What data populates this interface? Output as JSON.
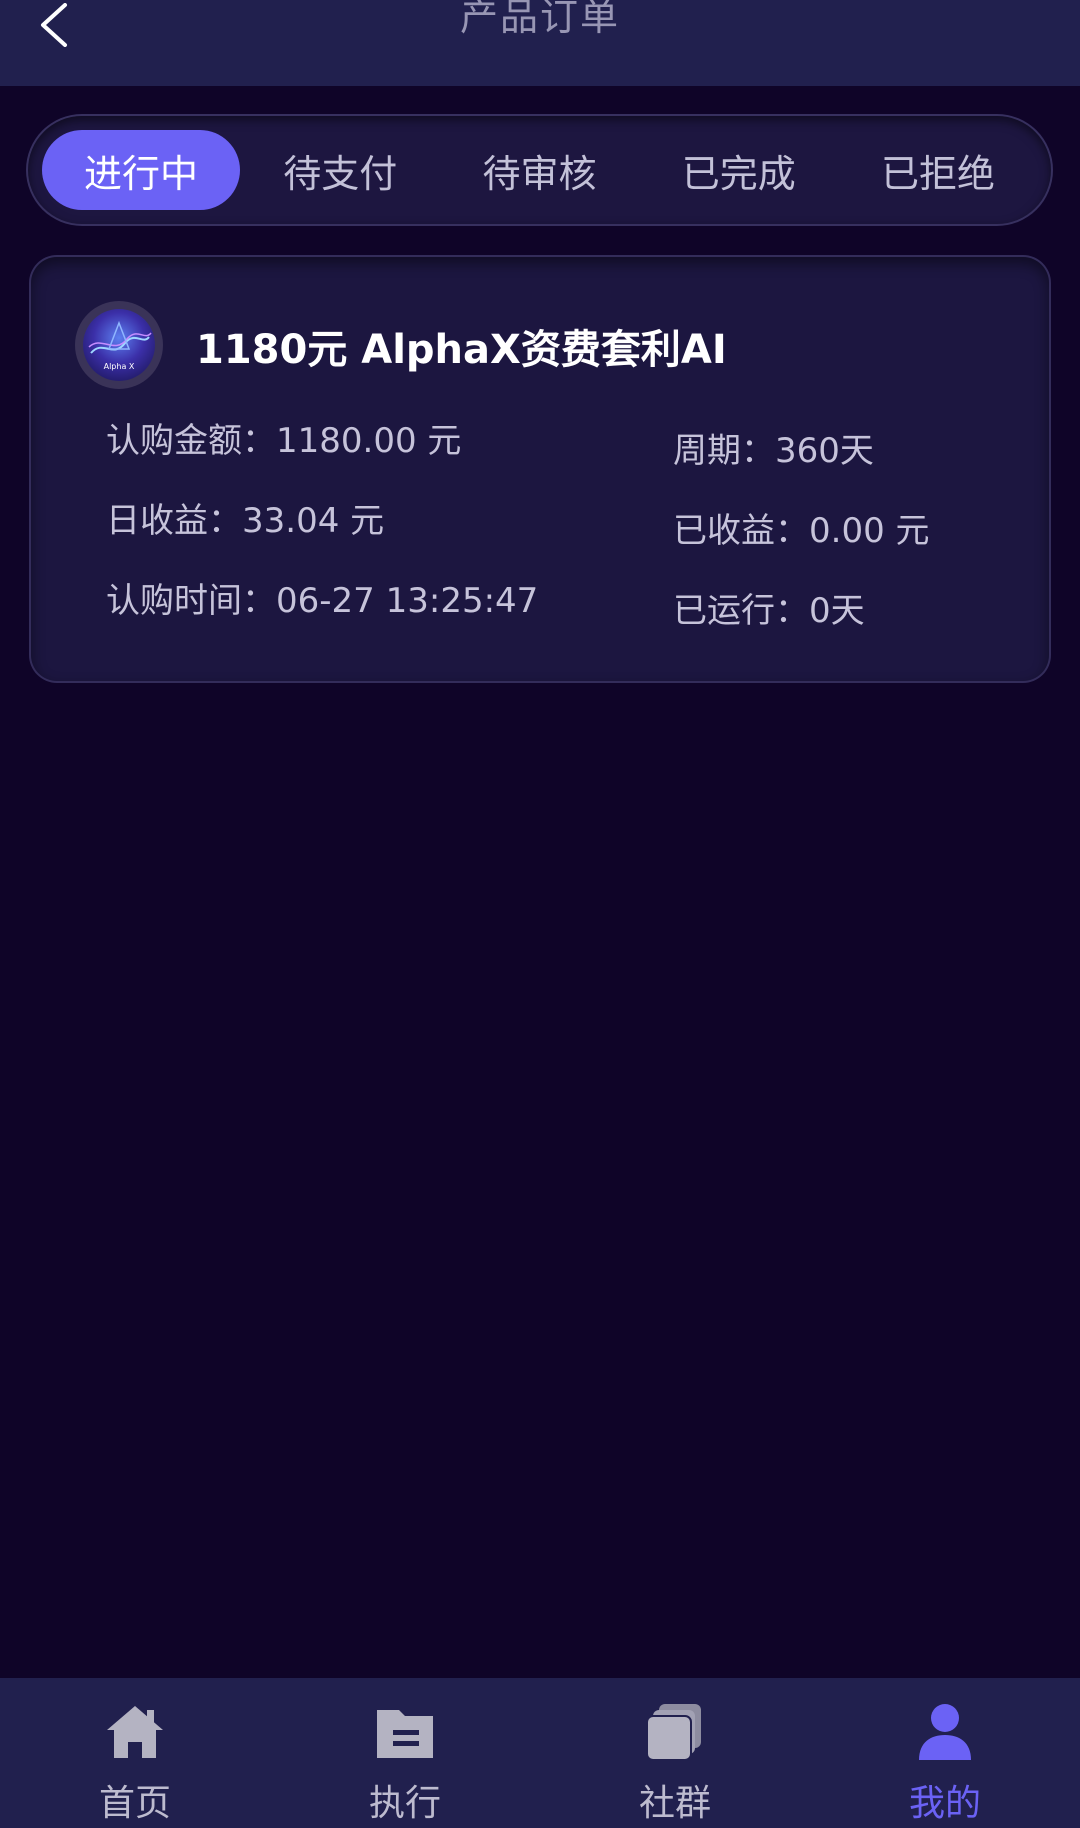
{
  "header": {
    "title": "产品订单"
  },
  "tabs": [
    {
      "label": "进行中",
      "active": true
    },
    {
      "label": "待支付",
      "active": false
    },
    {
      "label": "待审核",
      "active": false
    },
    {
      "label": "已完成",
      "active": false
    },
    {
      "label": "已拒绝",
      "active": false
    }
  ],
  "order": {
    "title": "1180元 AlphaX资费套利AI",
    "logo_text": "Alpha X",
    "amount": "认购金额：1180.00 元",
    "cycle": "周期：360天",
    "daily_income": "日收益：33.04 元",
    "earned": "已收益：0.00 元",
    "purchase_time": "认购时间：06-27 13:25:47",
    "running": "已运行：0天"
  },
  "nav": [
    {
      "label": "首页",
      "icon": "home-icon",
      "active": false
    },
    {
      "label": "执行",
      "icon": "folder-icon",
      "active": false
    },
    {
      "label": "社群",
      "icon": "cards-icon",
      "active": false
    },
    {
      "label": "我的",
      "icon": "user-icon",
      "active": true
    }
  ],
  "colors": {
    "background": "#0f0428",
    "bar": "#21204e",
    "accent": "#6b62f5",
    "inactive_icon": "#b4b3c2"
  }
}
